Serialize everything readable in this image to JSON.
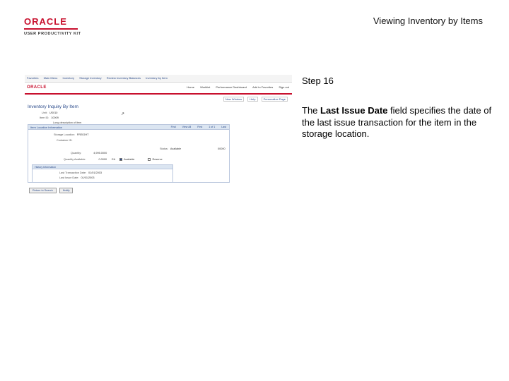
{
  "header": {
    "logo_word": "ORACLE",
    "logo_sub": "USER PRODUCTIVITY KIT",
    "title": "Viewing Inventory by Items"
  },
  "step": {
    "label": "Step 16",
    "desc_before": "The ",
    "desc_bold": "Last Issue Date",
    "desc_after": " field specifies the date of the last issue transaction for the item in the storage location."
  },
  "screenshot": {
    "crumbs": [
      "Favorites",
      "Main Menu",
      "Inventory",
      "Storage Inventory",
      "Review Inventory Balances",
      "Inventory by Item"
    ],
    "brand": "ORACLE",
    "toplinks": [
      "Home",
      "Worklist",
      "Performance Dashboard",
      "Add to Favorites",
      "Sign out"
    ],
    "subnav": [
      "New Window",
      "Help",
      "Personalize Page"
    ],
    "page_title": "Inventory Inquiry By Item",
    "unit_label": "Unit:",
    "unit_value": "US010",
    "item_label": "Item ID:",
    "item_value": "10009",
    "item_desc": "Long description of item",
    "section_title": "Item Location Information",
    "section_nav": [
      "Find",
      "View All",
      "First",
      "1 of 1",
      "Last"
    ],
    "storage_label": "Storage Location:",
    "storage_value": "FREIGHT",
    "container_label": "Container ID:",
    "status_label": "Status:",
    "status_value": "Available",
    "status_code": "00000",
    "quantity_label": "Quantity:",
    "quantity_value": "4,995.0000",
    "qty_avail_label": "Quantity Available:",
    "qty_avail_value": "0.0000",
    "uom": "EA",
    "check_available": "Available",
    "check_reserved": "Reserve",
    "history_title": "History Information",
    "last_txn_label": "Last Transaction Date:",
    "last_txn_value": "01/01/2003",
    "last_issue_label": "Last Issue Date:",
    "last_issue_value": "01/01/2003",
    "buttons": [
      "Return to Search",
      "Notify"
    ]
  }
}
